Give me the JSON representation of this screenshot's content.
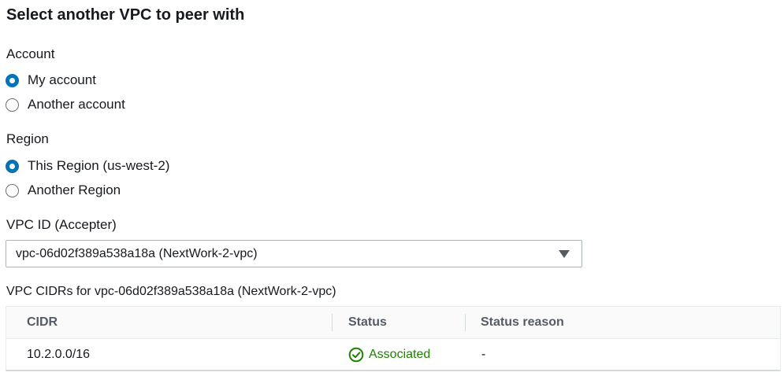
{
  "section_title": "Select another VPC to peer with",
  "account": {
    "label": "Account",
    "options": [
      {
        "label": "My account",
        "checked": true
      },
      {
        "label": "Another account",
        "checked": false
      }
    ]
  },
  "region": {
    "label": "Region",
    "options": [
      {
        "label": "This Region (us-west-2)",
        "checked": true
      },
      {
        "label": "Another Region",
        "checked": false
      }
    ]
  },
  "vpc_id": {
    "label": "VPC ID (Accepter)",
    "value": "vpc-06d02f389a538a18a (NextWork-2-vpc)"
  },
  "cidr_table": {
    "heading": "VPC CIDRs for vpc-06d02f389a538a18a (NextWork-2-vpc)",
    "columns": [
      "CIDR",
      "Status",
      "Status reason"
    ],
    "rows": [
      {
        "cidr": "10.2.0.0/16",
        "status": "Associated",
        "status_reason": "-"
      }
    ],
    "status_color": "#1d8102",
    "status_icon": "check-circle-icon"
  },
  "accent_color": "#0073bb"
}
